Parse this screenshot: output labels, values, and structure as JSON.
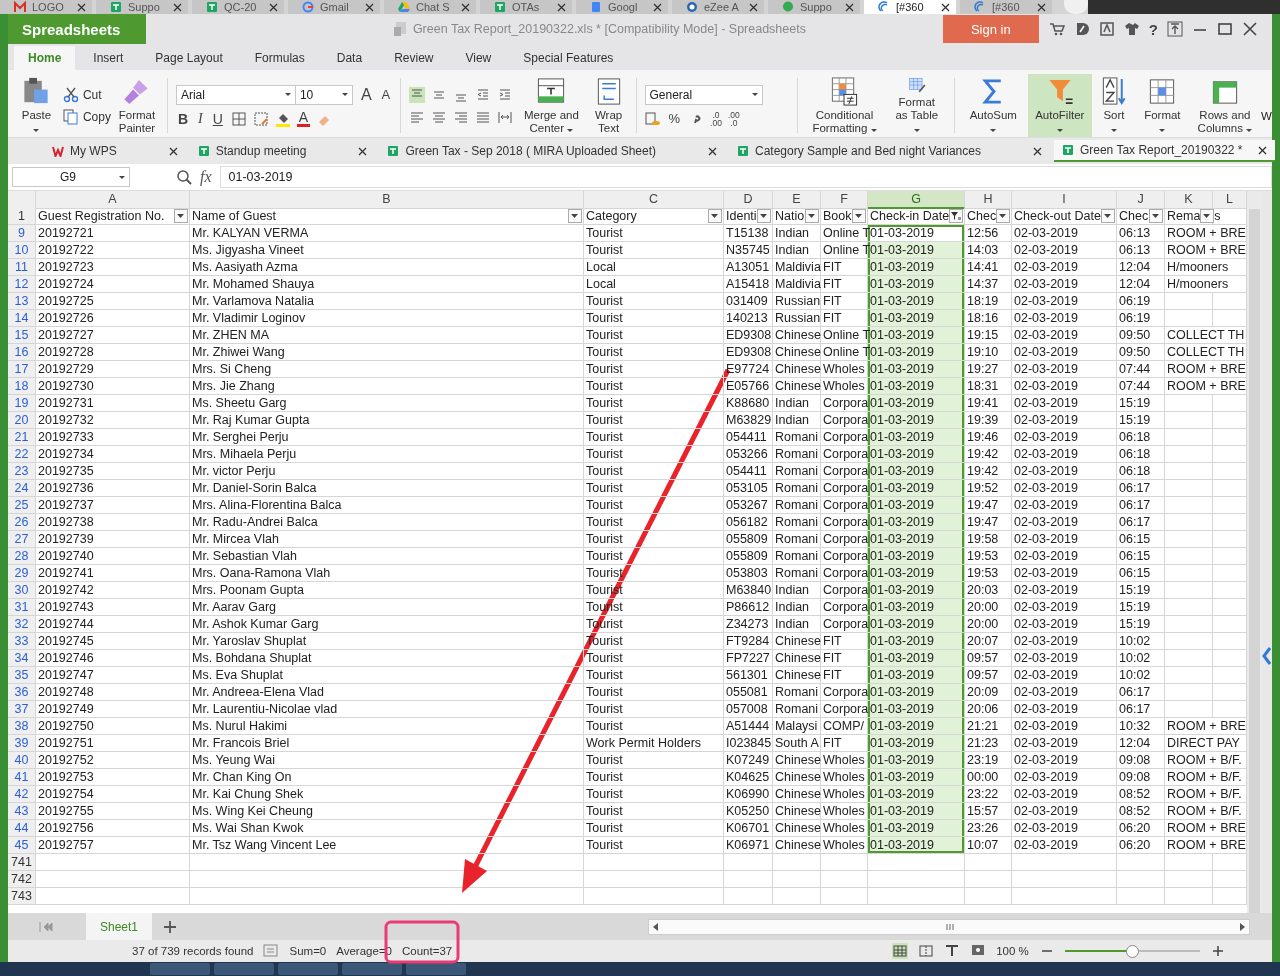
{
  "browser_tabs": [
    {
      "label": "LOGO",
      "kind": "mail",
      "selected": false
    },
    {
      "label": "Suppo",
      "kind": "sheet",
      "selected": false
    },
    {
      "label": "QC-20",
      "kind": "sheet",
      "selected": false
    },
    {
      "label": "Gmail",
      "kind": "google",
      "selected": false
    },
    {
      "label": "Chat S",
      "kind": "drive",
      "selected": false
    },
    {
      "label": "OTAs",
      "kind": "sheet",
      "selected": false
    },
    {
      "label": "Googl",
      "kind": "docs",
      "selected": false
    },
    {
      "label": "eZee A",
      "kind": "ezee",
      "selected": false
    },
    {
      "label": "Suppo",
      "kind": "chat",
      "selected": false
    },
    {
      "label": "[#360",
      "kind": "ticket",
      "selected": true
    },
    {
      "label": "[#360",
      "kind": "ticket",
      "selected": false
    }
  ],
  "title_bar": {
    "app": "Spreadsheets",
    "title": "Green Tax Report_20190322.xls * [Compatibility Mode] - Spreadsheets",
    "sign_in": "Sign in",
    "help": "?"
  },
  "menu_tabs": [
    {
      "label": "Home",
      "selected": true
    },
    {
      "label": "Insert",
      "selected": false
    },
    {
      "label": "Page Layout",
      "selected": false
    },
    {
      "label": "Formulas",
      "selected": false
    },
    {
      "label": "Data",
      "selected": false
    },
    {
      "label": "Review",
      "selected": false
    },
    {
      "label": "View",
      "selected": false
    },
    {
      "label": "Special Features",
      "selected": false
    }
  ],
  "ribbon": {
    "paste": "Paste",
    "cut": "Cut",
    "copy": "Copy",
    "format_painter": "Format Painter",
    "font": "Arial",
    "size": "10",
    "grow": "A",
    "shrink": "A",
    "bold": "B",
    "italic": "I",
    "underline": "U",
    "font_color": "A",
    "number_format": "General",
    "percent": "%",
    "increase_decimal": [
      ".0",
      ".00"
    ],
    "decrease_decimal": [
      ".00",
      ".0"
    ],
    "overflow_label": "W",
    "big_buttons": [
      {
        "label": "Merge and Center",
        "kind": "merge",
        "dropdown": true,
        "active": false
      },
      {
        "label": "Wrap Text",
        "kind": "wrap",
        "dropdown": false,
        "active": false
      },
      {
        "label": "Conditional Formatting",
        "kind": "conditional",
        "dropdown": true,
        "active": false
      },
      {
        "label": "Format as Table",
        "kind": "table",
        "dropdown": true,
        "active": false
      },
      {
        "label": "AutoSum",
        "kind": "autosum",
        "dropdown": true,
        "active": false
      },
      {
        "label": "AutoFilter",
        "kind": "autofilter",
        "dropdown": true,
        "active": true
      },
      {
        "label": "Sort",
        "kind": "sort",
        "dropdown": true,
        "active": false
      },
      {
        "label": "Format",
        "kind": "format",
        "dropdown": true,
        "active": false
      },
      {
        "label": "Rows and Columns",
        "kind": "rows",
        "dropdown": true,
        "active": false
      }
    ]
  },
  "doc_tabs": [
    {
      "label": "My WPS",
      "kind": "wps",
      "selected": false
    },
    {
      "label": "Standup meeting",
      "kind": "sheet",
      "selected": false
    },
    {
      "label": "Green Tax - Sep 2018 ( MIRA Uploaded Sheet)",
      "kind": "sheet",
      "selected": false
    },
    {
      "label": "Category Sample and Bed night Variances",
      "kind": "sheet",
      "selected": false
    },
    {
      "label": "Green Tax Report_20190322 *",
      "kind": "sheet",
      "selected": true
    }
  ],
  "formula_bar": {
    "cell": "G9",
    "fx": "fx",
    "value": "01-03-2019"
  },
  "sheet": {
    "columns": [
      {
        "letter": "A",
        "selected": false
      },
      {
        "letter": "B",
        "selected": false
      },
      {
        "letter": "C",
        "selected": false
      },
      {
        "letter": "D",
        "selected": false
      },
      {
        "letter": "E",
        "selected": false
      },
      {
        "letter": "F",
        "selected": false
      },
      {
        "letter": "G",
        "selected": true
      },
      {
        "letter": "H",
        "selected": false
      },
      {
        "letter": "I",
        "selected": false
      },
      {
        "letter": "J",
        "selected": false
      },
      {
        "letter": "K",
        "selected": false
      },
      {
        "letter": "L",
        "selected": false
      }
    ],
    "header_row": {
      "n": "1",
      "headers": [
        {
          "label": "Guest Registration No.",
          "filtered": false
        },
        {
          "label": "Name of Guest",
          "filtered": false
        },
        {
          "label": "Category",
          "filtered": false
        },
        {
          "label": "Identi",
          "filtered": false
        },
        {
          "label": "Natio",
          "filtered": false
        },
        {
          "label": "Book",
          "filtered": false
        },
        {
          "label": "Check-in Date",
          "filtered": true
        },
        {
          "label": "Chec",
          "filtered": false
        },
        {
          "label": "Check-out Date",
          "filtered": false
        },
        {
          "label": "Chec",
          "filtered": false
        },
        {
          "label": "Rema",
          "tail": "s",
          "filtered": false
        }
      ]
    },
    "rows": [
      {
        "n": "9",
        "active": true,
        "cells": [
          "20192721",
          "Mr. KALYAN VERMA",
          "Tourist",
          "T15138",
          "Indian",
          "Online T",
          "01-03-2019",
          "12:56",
          "02-03-2019",
          "06:13"
        ],
        "remark": "ROOM + BRE"
      },
      {
        "n": "10",
        "active": false,
        "cells": [
          "20192722",
          "Ms. Jigyasha Vineet",
          "Tourist",
          "N35745",
          "Indian",
          "Online T",
          "01-03-2019",
          "14:03",
          "02-03-2019",
          "06:13"
        ],
        "remark": "ROOM + BRE"
      },
      {
        "n": "11",
        "active": false,
        "cells": [
          "20192723",
          "Ms. Aasiyath Azma",
          "Local",
          "A13051",
          "Maldivia",
          "FIT",
          "01-03-2019",
          "14:41",
          "02-03-2019",
          "12:04"
        ],
        "remark": "H/mooners"
      },
      {
        "n": "12",
        "active": false,
        "cells": [
          "20192724",
          "Mr. Mohamed Shauya",
          "Local",
          "A15418",
          "Maldivia",
          "FIT",
          "01-03-2019",
          "14:37",
          "02-03-2019",
          "12:04"
        ],
        "remark": "H/mooners"
      },
      {
        "n": "13",
        "active": false,
        "cells": [
          "20192725",
          "Mr. Varlamova Natalia",
          "Tourist",
          "031409",
          "Russian",
          "FIT",
          "01-03-2019",
          "18:19",
          "02-03-2019",
          "06:19"
        ]
      },
      {
        "n": "14",
        "active": false,
        "cells": [
          "20192726",
          "Mr. Vladimir Loginov",
          "Tourist",
          "140213",
          "Russian",
          "FIT",
          "01-03-2019",
          "18:16",
          "02-03-2019",
          "06:19"
        ]
      },
      {
        "n": "15",
        "active": false,
        "cells": [
          "20192727",
          "Mr. ZHEN MA",
          "Tourist",
          "ED9308",
          "Chinese",
          "Online T",
          "01-03-2019",
          "19:15",
          "02-03-2019",
          "09:50"
        ],
        "remark": "COLLECT TH"
      },
      {
        "n": "16",
        "active": false,
        "cells": [
          "20192728",
          "Mr. Zhiwei Wang",
          "Tourist",
          "ED9308",
          "Chinese",
          "Online T",
          "01-03-2019",
          "19:10",
          "02-03-2019",
          "09:50"
        ],
        "remark": "COLLECT TH"
      },
      {
        "n": "17",
        "active": false,
        "cells": [
          "20192729",
          "Mrs. Si Cheng",
          "Tourist",
          "E97724",
          "Chinese",
          "Wholes",
          "01-03-2019",
          "19:27",
          "02-03-2019",
          "07:44"
        ],
        "remark": "ROOM + BRE"
      },
      {
        "n": "18",
        "active": false,
        "cells": [
          "20192730",
          "Mrs. Jie Zhang",
          "Tourist",
          "E05766",
          "Chinese",
          "Wholes",
          "01-03-2019",
          "18:31",
          "02-03-2019",
          "07:44"
        ],
        "remark": "ROOM + BRE"
      },
      {
        "n": "19",
        "active": false,
        "cells": [
          "20192731",
          "Ms. Sheetu Garg",
          "Tourist",
          "K88680",
          "Indian",
          "Corpora",
          "01-03-2019",
          "19:41",
          "02-03-2019",
          "15:19"
        ]
      },
      {
        "n": "20",
        "active": false,
        "cells": [
          "20192732",
          "Mr. Raj Kumar Gupta",
          "Tourist",
          "M63829",
          "Indian",
          "Corpora",
          "01-03-2019",
          "19:39",
          "02-03-2019",
          "15:19"
        ]
      },
      {
        "n": "21",
        "active": false,
        "cells": [
          "20192733",
          "Mr. Serghei Perju",
          "Tourist",
          "054411",
          "Romani",
          "Corpora",
          "01-03-2019",
          "19:46",
          "02-03-2019",
          "06:18"
        ]
      },
      {
        "n": "22",
        "active": false,
        "cells": [
          "20192734",
          "Mrs. Mihaela Perju",
          "Tourist",
          "053266",
          "Romani",
          "Corpora",
          "01-03-2019",
          "19:42",
          "02-03-2019",
          "06:18"
        ]
      },
      {
        "n": "23",
        "active": false,
        "cells": [
          "20192735",
          "Mr. victor Perju",
          "Tourist",
          "054411",
          "Romani",
          "Corpora",
          "01-03-2019",
          "19:42",
          "02-03-2019",
          "06:18"
        ]
      },
      {
        "n": "24",
        "active": false,
        "cells": [
          "20192736",
          "Mr. Daniel-Sorin Balca",
          "Tourist",
          "053105",
          "Romani",
          "Corpora",
          "01-03-2019",
          "19:52",
          "02-03-2019",
          "06:17"
        ]
      },
      {
        "n": "25",
        "active": false,
        "cells": [
          "20192737",
          "Mrs. Alina-Florentina Balca",
          "Tourist",
          "053267",
          "Romani",
          "Corpora",
          "01-03-2019",
          "19:47",
          "02-03-2019",
          "06:17"
        ]
      },
      {
        "n": "26",
        "active": false,
        "cells": [
          "20192738",
          "Mr. Radu-Andrei Balca",
          "Tourist",
          "056182",
          "Romani",
          "Corpora",
          "01-03-2019",
          "19:47",
          "02-03-2019",
          "06:17"
        ]
      },
      {
        "n": "27",
        "active": false,
        "cells": [
          "20192739",
          "Mr. Mircea Vlah",
          "Tourist",
          "055809",
          "Romani",
          "Corpora",
          "01-03-2019",
          "19:58",
          "02-03-2019",
          "06:15"
        ]
      },
      {
        "n": "28",
        "active": false,
        "cells": [
          "20192740",
          "Mr. Sebastian Vlah",
          "Tourist",
          "055809",
          "Romani",
          "Corpora",
          "01-03-2019",
          "19:53",
          "02-03-2019",
          "06:15"
        ]
      },
      {
        "n": "29",
        "active": false,
        "cells": [
          "20192741",
          "Mrs. Oana-Ramona Vlah",
          "Tourist",
          "053803",
          "Romani",
          "Corpora",
          "01-03-2019",
          "19:53",
          "02-03-2019",
          "06:15"
        ]
      },
      {
        "n": "30",
        "active": false,
        "cells": [
          "20192742",
          "Mrs. Poonam Gupta",
          "Tourist",
          "M63840",
          "Indian",
          "Corpora",
          "01-03-2019",
          "20:03",
          "02-03-2019",
          "15:19"
        ]
      },
      {
        "n": "31",
        "active": false,
        "cells": [
          "20192743",
          "Mr. Aarav Garg",
          "Tourist",
          "P86612",
          "Indian",
          "Corpora",
          "01-03-2019",
          "20:00",
          "02-03-2019",
          "15:19"
        ]
      },
      {
        "n": "32",
        "active": false,
        "cells": [
          "20192744",
          "Mr. Ashok Kumar Garg",
          "Tourist",
          "Z34273",
          "Indian",
          "Corpora",
          "01-03-2019",
          "20:00",
          "02-03-2019",
          "15:19"
        ]
      },
      {
        "n": "33",
        "active": false,
        "cells": [
          "20192745",
          "Mr. Yaroslav Shuplat",
          "Tourist",
          "FT9284",
          "Chinese",
          "FIT",
          "01-03-2019",
          "20:07",
          "02-03-2019",
          "10:02"
        ]
      },
      {
        "n": "34",
        "active": false,
        "cells": [
          "20192746",
          "Ms. Bohdana Shuplat",
          "Tourist",
          "FP7227",
          "Chinese",
          "FIT",
          "01-03-2019",
          "09:57",
          "02-03-2019",
          "10:02"
        ]
      },
      {
        "n": "35",
        "active": false,
        "cells": [
          "20192747",
          "Ms. Eva Shuplat",
          "Tourist",
          "561301",
          "Chinese",
          "FIT",
          "01-03-2019",
          "09:57",
          "02-03-2019",
          "10:02"
        ]
      },
      {
        "n": "36",
        "active": false,
        "cells": [
          "20192748",
          "Mr. Andreea-Elena Vlad",
          "Tourist",
          "055081",
          "Romani",
          "Corpora",
          "01-03-2019",
          "20:09",
          "02-03-2019",
          "06:17"
        ]
      },
      {
        "n": "37",
        "active": false,
        "cells": [
          "20192749",
          "Mr. Laurentiu-Nicolae vlad",
          "Tourist",
          "057008",
          "Romani",
          "Corpora",
          "01-03-2019",
          "20:06",
          "02-03-2019",
          "06:17"
        ]
      },
      {
        "n": "38",
        "active": false,
        "cells": [
          "20192750",
          "Ms. Nurul Hakimi",
          "Tourist",
          "A51444",
          "Malaysi",
          "COMP/",
          "01-03-2019",
          "21:21",
          "02-03-2019",
          "10:32"
        ],
        "remark": "ROOM + BRE"
      },
      {
        "n": "39",
        "active": false,
        "cells": [
          "20192751",
          "Mr. Francois Briel",
          "Work Permit Holders",
          "I023845",
          "South A",
          "FIT",
          "01-03-2019",
          "21:23",
          "02-03-2019",
          "12:04"
        ],
        "remark": "DIRECT PAY"
      },
      {
        "n": "40",
        "active": false,
        "cells": [
          "20192752",
          "Ms. Yeung Wai",
          "Tourist",
          "K07249",
          "Chinese",
          "Wholes",
          "01-03-2019",
          "23:19",
          "02-03-2019",
          "09:08"
        ],
        "remark": "ROOM + B/F."
      },
      {
        "n": "41",
        "active": false,
        "cells": [
          "20192753",
          "Mr. Chan King On",
          "Tourist",
          "K04625",
          "Chinese",
          "Wholes",
          "01-03-2019",
          "00:00",
          "02-03-2019",
          "09:08"
        ],
        "remark": "ROOM + B/F."
      },
      {
        "n": "42",
        "active": false,
        "cells": [
          "20192754",
          "Mr. Kai Chung Shek",
          "Tourist",
          "K06990",
          "Chinese",
          "Wholes",
          "01-03-2019",
          "23:22",
          "02-03-2019",
          "08:52"
        ],
        "remark": "ROOM + B/F."
      },
      {
        "n": "43",
        "active": false,
        "cells": [
          "20192755",
          "Ms. Wing Kei Cheung",
          "Tourist",
          "K05250",
          "Chinese",
          "Wholes",
          "01-03-2019",
          "15:57",
          "02-03-2019",
          "08:52"
        ],
        "remark": "ROOM + B/F."
      },
      {
        "n": "44",
        "active": false,
        "cells": [
          "20192756",
          "Ms. Wai Shan Kwok",
          "Tourist",
          "K06701",
          "Chinese",
          "Wholes",
          "01-03-2019",
          "23:26",
          "02-03-2019",
          "06:20"
        ],
        "remark": "ROOM + BRE"
      },
      {
        "n": "45",
        "active": false,
        "cells": [
          "20192757",
          "Mr. Tsz Wang Vincent Lee",
          "Tourist",
          "K06971",
          "Chinese",
          "Wholes",
          "01-03-2019",
          "10:07",
          "02-03-2019",
          "06:20"
        ],
        "remark": "ROOM + BRE"
      }
    ],
    "empty_rows": [
      "741",
      "742",
      "743"
    ]
  },
  "sheet_tabs": [
    {
      "label": "Sheet1",
      "selected": true
    }
  ],
  "status_bar": {
    "records": "37 of 739 records found",
    "sum": "Sum=0",
    "average": "Average=0",
    "count": "Count=37",
    "zoom": "100 %",
    "zoom_slider": {
      "level": 0.5
    }
  }
}
